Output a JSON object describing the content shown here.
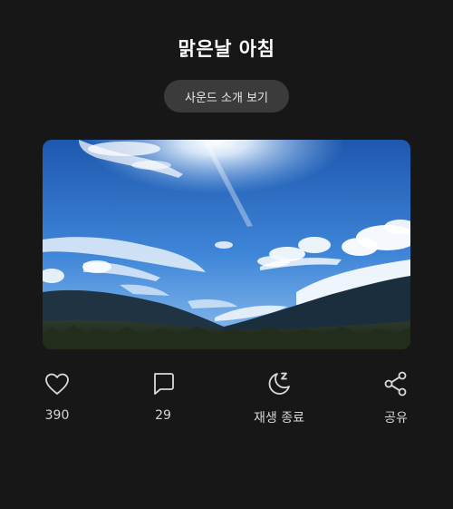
{
  "header": {
    "title": "맑은날 아침",
    "sound_button_label": "사운드 소개 보기"
  },
  "hero_image": {
    "description_icon": "sky-landscape-image"
  },
  "actions": {
    "like": {
      "icon": "heart-icon",
      "label": "390"
    },
    "comment": {
      "icon": "comment-icon",
      "label": "29"
    },
    "sleep_timer": {
      "icon": "moon-zzz-icon",
      "label": "재생 종료"
    },
    "share": {
      "icon": "share-icon",
      "label": "공유"
    }
  },
  "colors": {
    "background": "#171717",
    "button_bg": "#3b3b3b",
    "text_secondary": "#d6d6d6",
    "sky_top": "#1f5fb8",
    "sky_bottom": "#6aa8e8",
    "mountain": "#1c2f3f"
  }
}
